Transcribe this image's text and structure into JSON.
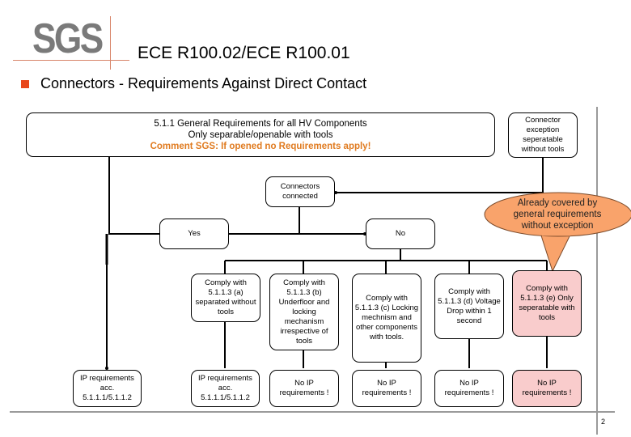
{
  "header": {
    "logo": "SGS",
    "title": "ECE R100.02/ECE R100.01",
    "subtitle": "Connectors - Requirements Against Direct Contact"
  },
  "colors": {
    "bullet": "#e8461a",
    "comment": "#e07b20",
    "callout": "#f9a36b",
    "highlight": "#f9cccc",
    "logo": "#7a7a7a"
  },
  "diagram": {
    "general": {
      "line1": "5.1.1 General Requirements for all HV Components",
      "line2": "Only separable/openable with tools",
      "comment": "Comment SGS: If opened  no  Requirements apply!"
    },
    "exception": "Connector exception seperatable without tools",
    "connected": "Connectors connected",
    "yes": "Yes",
    "no": "No",
    "callout": "Already covered by general requirements without exception",
    "comply": [
      "Comply with 5.1.1.3 (a) separated without tools",
      "Comply with 5.1.1.3 (b) Underfloor and locking mechanism irrespective of tools",
      "Comply with 5.1.1.3 (c) Locking mechnism and other components with tools.",
      "Comply with 5.1.1.3 (d) Voltage Drop within 1 second",
      "Comply with 5.1.1.3 (e) Only seperatable with tools"
    ],
    "results": [
      "IP requirements acc. 5.1.1.1/5.1.1.2",
      "IP requirements acc. 5.1.1.1/5.1.1.2",
      "No IP requirements !",
      "No IP requirements !",
      "No IP requirements !",
      "No IP requirements !"
    ]
  },
  "footer": {
    "page": "2"
  }
}
